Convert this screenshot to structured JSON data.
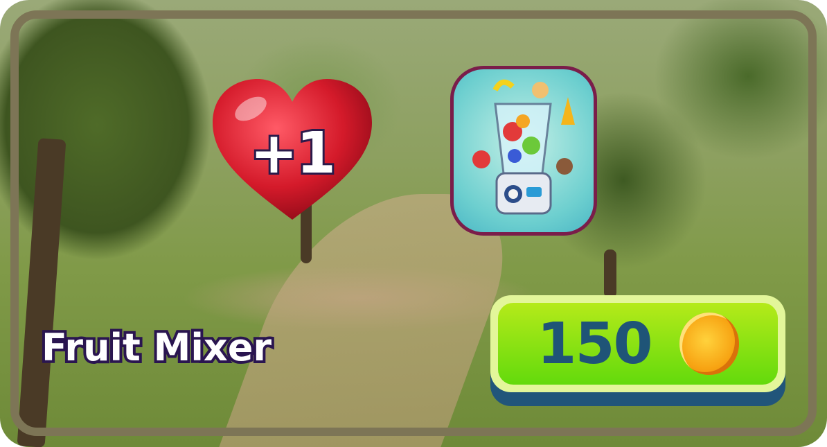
{
  "reward": {
    "lives_label": "+1",
    "heart_icon": "heart-icon"
  },
  "item": {
    "name": "Fruit Mixer",
    "image_icon": "blender-icon"
  },
  "purchase": {
    "price": "150",
    "currency_icon": "coin-icon"
  },
  "colors": {
    "frame": "#7d7556",
    "button_green": "#63da0c",
    "price_text": "#1f5477",
    "title_outline": "#2a1550",
    "heart_red": "#d41a2a"
  }
}
